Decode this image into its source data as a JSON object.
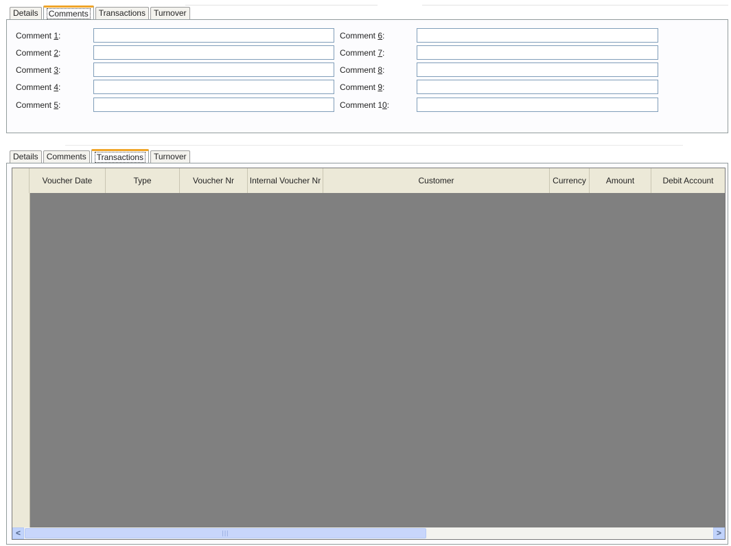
{
  "top_tabs": {
    "items": [
      "Details",
      "Comments",
      "Transactions",
      "Turnover"
    ],
    "active": "Comments"
  },
  "comments": {
    "left": [
      {
        "pre": "Comment ",
        "key": "1",
        "post": ":",
        "value": ""
      },
      {
        "pre": "Comment ",
        "key": "2",
        "post": ":",
        "value": ""
      },
      {
        "pre": "Comment ",
        "key": "3",
        "post": ":",
        "value": ""
      },
      {
        "pre": "Comment ",
        "key": "4",
        "post": ":",
        "value": ""
      },
      {
        "pre": "Comment ",
        "key": "5",
        "post": ":",
        "value": ""
      }
    ],
    "right": [
      {
        "pre": "Comment ",
        "key": "6",
        "post": ":",
        "value": ""
      },
      {
        "pre": "Comment ",
        "key": "7",
        "post": ":",
        "value": ""
      },
      {
        "pre": "Comment ",
        "key": "8",
        "post": ":",
        "value": ""
      },
      {
        "pre": "Comment ",
        "key": "9",
        "post": ":",
        "value": ""
      },
      {
        "pre": "Comment 1",
        "key": "0",
        "post": ":",
        "value": ""
      }
    ]
  },
  "bottom_tabs": {
    "items": [
      "Details",
      "Comments",
      "Transactions",
      "Turnover"
    ],
    "active": "Transactions"
  },
  "transactions_grid": {
    "columns": [
      "",
      "Voucher Date",
      "Type",
      "Voucher Nr",
      "Internal Voucher Nr",
      "Customer",
      "Currency",
      "Amount",
      "Debit Account"
    ],
    "rows": []
  },
  "scrollbar": {
    "left_arrow": "<",
    "right_arrow": ">",
    "thumb_grip": "|||"
  },
  "colors": {
    "active_tab_accent": "#f0a528",
    "grid_background": "#808080",
    "header_background": "#ece9d8",
    "field_border": "#7f9db9"
  }
}
